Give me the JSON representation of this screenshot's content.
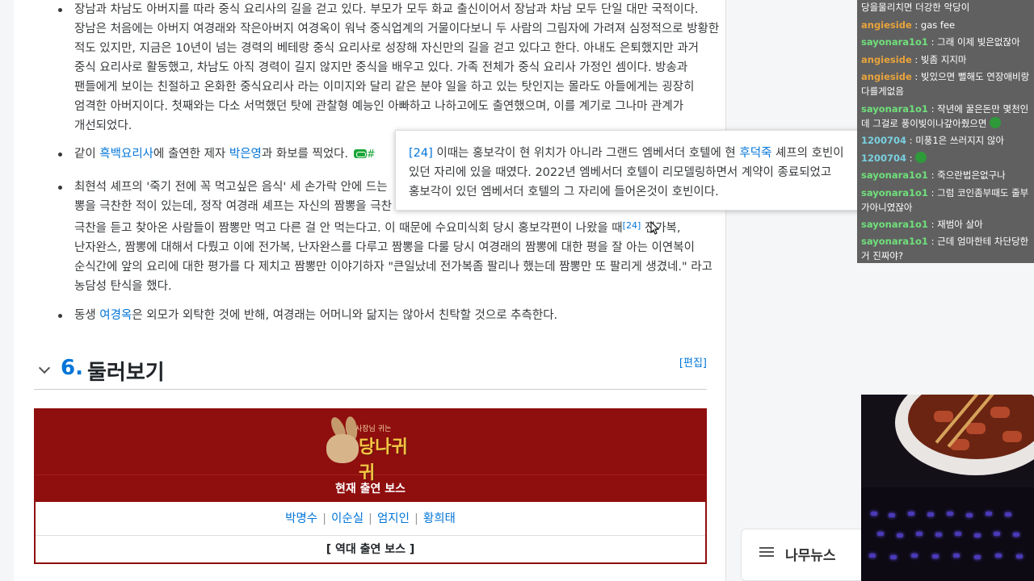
{
  "article": {
    "bullet1": "장남과 차남도 아버지를 따라 중식 요리사의 길을 걷고 있다. 부모가 모두 화교 출신이어서 장남과 차남 모두 단일 대만 국적이다. 장남은 처음에는 아버지 여경래와 작은아버지 여경옥이 워낙 중식업계의 거물이다보니 두 사람의 그림자에 가려져 심정적으로 방황한 적도 있지만, 지금은 10년이 넘는 경력의 베테랑 중식 요리사로 성장해 자신만의 길을 걷고 있다고 한다. 아내도 은퇴했지만 과거 중식 요리사로 활동했고, 차남도 아직 경력이 길지 않지만 중식을 배우고 있다. 가족 전체가 중식 요리사 가정인 셈이다. 방송과 팬들에게 보이는 친절하고 온화한 중식요리사 라는 이미지와 달리 같은 분야 일을 하고 있는 탓인지는 몰라도 아들에게는 굉장히 엄격한 아버지이다. 첫째와는 다소 서먹했던 탓에 관찰형 예능인 아빠하고 나하고에도 출연했으며, 이를 계기로 그나마 관계가 개선되었다.",
    "bullet2_pre": "같이 ",
    "bullet2_link1": "흑백요리사",
    "bullet2_mid": "에 출연한 제자 ",
    "bullet2_link2": "박은영",
    "bullet2_post": "과 화보를 찍었다. ",
    "bullet2_hash": "#",
    "bullet3_a": "최현석 셰프의 '죽기 전에 꼭 먹고싶은 음식' 세 손가락 안에 드는 ",
    "bullet3_b": "뽕을 극찬한 적이 있는데, 정작 여경래 셰프는 자신의 짬뽕을 극찬",
    "bullet3_c": "극찬을 듣고 찾아온 사람들이 짬뽕만 먹고 다른 걸 안 먹는다고. 이 때문에 수요미식회 당시 홍보각편이 나왔을 때",
    "bullet3_fn": "[24]",
    "bullet3_d": " 전가복, 난자완스, 짬뽕에 대해서 다뤘고 이에 전가복, 난자완스를 다루고 짬뽕을 다룰 당시 여경래의 짬뽕에 대한 평을 잘 아는 이연복이 순식간에 앞의 요리에 대한 평가를 다 제치고 짬뽕만 이야기하자 \"큰일났네 전가복좀 팔리나 했는데 짬뽕만 또 팔리게 생겼네.\" 라고 농담성 탄식을 했다.",
    "bullet4_pre": "동생 ",
    "bullet4_link": "여경옥",
    "bullet4_post": "은 외모가 외탁한 것에 반해, 여경래는 어머니와 닮지는 않아서 친탁할 것으로 추측한다."
  },
  "section": {
    "number": "6.",
    "title": "둘러보기",
    "edit": "[편집]"
  },
  "navbox": {
    "logo_sub": "사장님 귀는",
    "logo_name": "당나귀 귀",
    "title": "현재 출연 보스",
    "members": [
      "박명수",
      "이순실",
      "엄지인",
      "황희태"
    ],
    "past": "[ 역대 출연 보스 ]"
  },
  "tooltip": {
    "fn": "[24]",
    "text_a": " 이때는 홍보각이 현 위치가 아니라 그랜드 엠베서더 호텔에 현 ",
    "link": "후덕죽",
    "text_b": " 셰프의 호빈이 있던 자리에 있을 때였다. 2022년 엠베서더 호텔이 리모델링하면서 계약이 종료되었고 홍보각이 있던 엠베서더 호텔의 그 자리에 들어온것이 호빈이다."
  },
  "chat": [
    {
      "user": "",
      "msg": "당을물리치면 더강한 악당이",
      "color": "#ffffff"
    },
    {
      "user": "angieside",
      "msg": " : gas fee",
      "color": "#e8a33b"
    },
    {
      "user": "sayonara1o1",
      "msg": " : 그래 이제 빚은없잖아",
      "color": "#6fe07a"
    },
    {
      "user": "angieside",
      "msg": " : 빚좀 지지마",
      "color": "#e8a33b"
    },
    {
      "user": "angieside",
      "msg": " : 빚있으면 뻘해도 연장애비랑 다를게없음",
      "color": "#e8a33b"
    },
    {
      "user": "sayonara1o1",
      "msg": " : 작년에 꿀은돈만 몇천인데 그걸로 풍이빚이나갚아줬으면",
      "color": "#6fe07a"
    },
    {
      "user": "1200704",
      "msg": " : 미풍1은 쓰러지지 않아",
      "color": "#7ad0e0"
    },
    {
      "user": "1200704",
      "msg": " : ",
      "color": "#7ad0e0"
    },
    {
      "user": "sayonara1o1",
      "msg": " : 죽으란법은없구나",
      "color": "#6fe07a"
    },
    {
      "user": "sayonara1o1",
      "msg": " : 그럼 코인좀부때도 줄부가아니였잖아",
      "color": "#6fe07a"
    },
    {
      "user": "sayonara1o1",
      "msg": " : 재범아 살아",
      "color": "#6fe07a"
    },
    {
      "user": "sayonara1o1",
      "msg": " : 근데 엄마한테 차단당한거 진짜야?",
      "color": "#6fe07a"
    }
  ],
  "news": {
    "label": "나무뉴스"
  },
  "colors": {
    "link": "#0275d8",
    "navbox": "#8f0e0e",
    "hash": "#18a538"
  }
}
